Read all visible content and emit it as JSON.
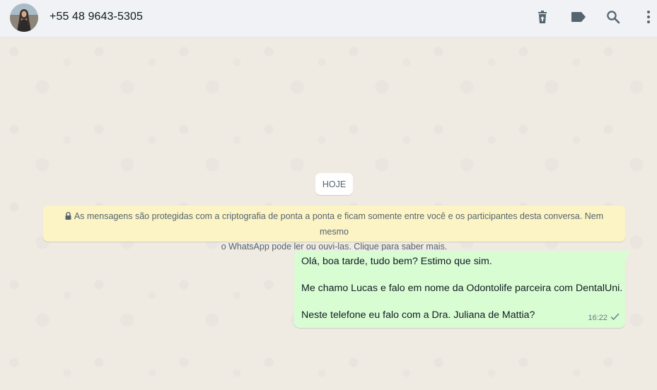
{
  "header": {
    "contact_name": "+55 48 9643-5305",
    "icons": [
      "delete-icon",
      "label-icon",
      "search-icon",
      "menu-icon"
    ]
  },
  "chat": {
    "day_label": "HOJE",
    "encryption_notice": {
      "line1": "As mensagens são protegidas com a criptografia de ponta a ponta e ficam somente entre você e os participantes desta conversa. Nem mesmo",
      "line2": "o WhatsApp pode ler ou ouvi-las. Clique para saber mais."
    },
    "messages": [
      {
        "direction": "outgoing",
        "lines": [
          "Olá, boa tarde, tudo bem? Estimo que sim.",
          "Me chamo Lucas e falo em nome da Odontolife parceira com DentalUni.",
          "Neste telefone eu falo com a Dra. Juliana de Mattia?"
        ],
        "time": "16:22",
        "status": "sent-single-check"
      }
    ]
  },
  "colors": {
    "header_bg": "#f0f2f5",
    "chat_bg": "#efeae2",
    "outgoing_bubble": "#d9fdd3",
    "system_notice": "#fdf4c5",
    "icon_color": "#54656f"
  }
}
